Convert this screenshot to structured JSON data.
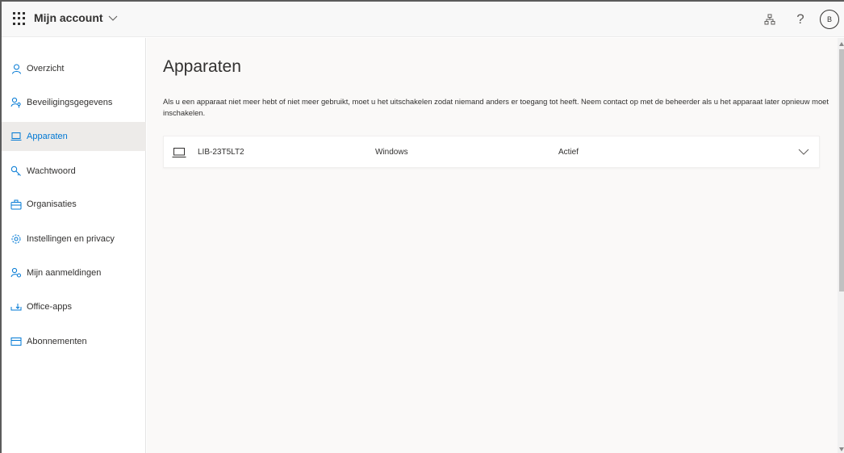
{
  "header": {
    "app_title": "Mijn account",
    "waffle_icon": "app-launcher-icon",
    "org_icon": "organization-icon",
    "help_label": "?",
    "avatar_initial": "B"
  },
  "sidebar": {
    "items": [
      {
        "label": "Overzicht",
        "icon": "person-icon"
      },
      {
        "label": "Beveiligingsgegevens",
        "icon": "security-info-icon"
      },
      {
        "label": "Apparaten",
        "icon": "laptop-icon",
        "active": true
      },
      {
        "label": "Wachtwoord",
        "icon": "key-icon"
      },
      {
        "label": "Organisaties",
        "icon": "briefcase-icon"
      },
      {
        "label": "Instellingen en privacy",
        "icon": "gear-icon"
      },
      {
        "label": "Mijn aanmeldingen",
        "icon": "sign-ins-icon"
      },
      {
        "label": "Office-apps",
        "icon": "download-icon"
      },
      {
        "label": "Abonnementen",
        "icon": "subscriptions-icon"
      }
    ]
  },
  "main": {
    "title": "Apparaten",
    "description": "Als u een apparaat niet meer hebt of niet meer gebruikt, moet u het uitschakelen zodat niemand anders er toegang tot heeft. Neem contact op met de beheerder als u het apparaat later opnieuw moet inschakelen.",
    "devices": [
      {
        "name": "LIB-23T5LT2",
        "os": "Windows",
        "status": "Actief"
      }
    ]
  },
  "colors": {
    "accent": "#0078d4",
    "active_bg": "#edebe9",
    "main_bg": "#faf9f8",
    "topbar_bg": "#f8f8f8"
  }
}
